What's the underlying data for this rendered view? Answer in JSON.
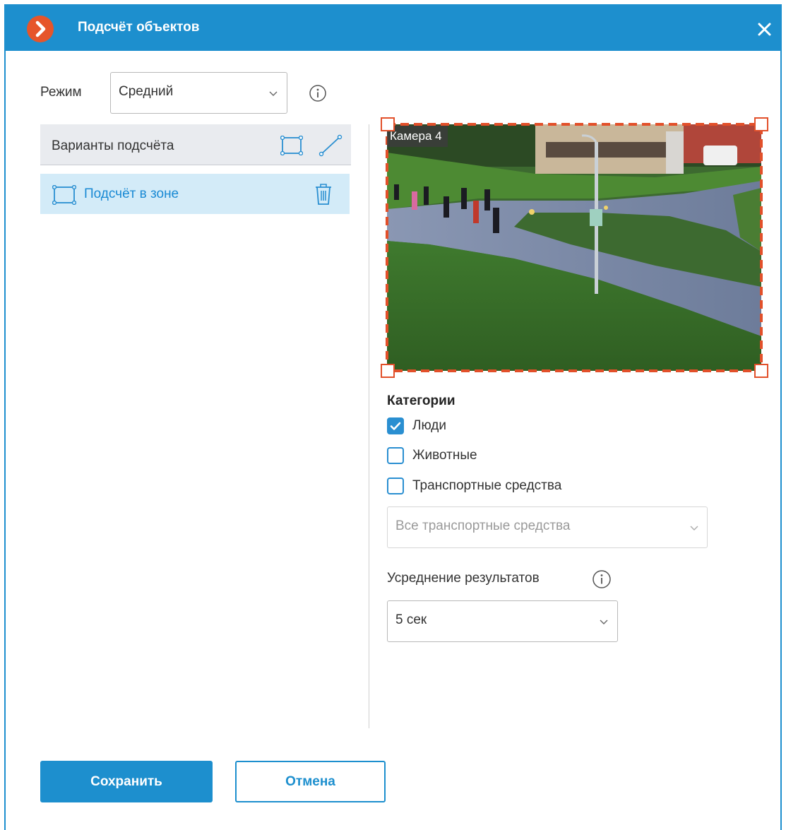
{
  "window": {
    "title": "Подсчёт объектов"
  },
  "mode": {
    "label": "Режим",
    "value": "Средний"
  },
  "variants": {
    "header": "Варианты подсчёта",
    "items": [
      {
        "label": "Подсчёт в зоне"
      }
    ]
  },
  "preview": {
    "camera_label": "Камера 4"
  },
  "categories": {
    "title": "Категории",
    "items": [
      {
        "label": "Люди",
        "checked": true
      },
      {
        "label": "Животные",
        "checked": false
      },
      {
        "label": "Транспортные средства",
        "checked": false
      }
    ],
    "vehicle_select": "Все транспортные средства"
  },
  "averaging": {
    "label": "Усреднение результатов",
    "value": "5 сек"
  },
  "buttons": {
    "save": "Сохранить",
    "cancel": "Отмена"
  },
  "colors": {
    "accent": "#1d8fce",
    "zone_border": "#e2502a",
    "selected_item_bg": "#d3ebf8"
  }
}
